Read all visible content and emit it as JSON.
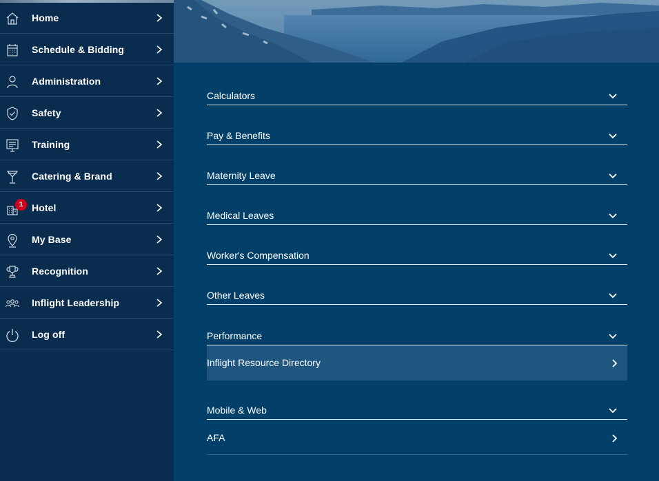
{
  "sidebar": {
    "items": [
      {
        "label": "Home",
        "icon": "home-icon"
      },
      {
        "label": "Schedule & Bidding",
        "icon": "calendar-icon"
      },
      {
        "label": "Administration",
        "icon": "person-icon"
      },
      {
        "label": "Safety",
        "icon": "shield-check-icon"
      },
      {
        "label": "Training",
        "icon": "presentation-board-icon"
      },
      {
        "label": "Catering & Brand",
        "icon": "cocktail-glass-icon"
      },
      {
        "label": "Hotel",
        "icon": "hotel-building-icon",
        "badge": "1"
      },
      {
        "label": "My Base",
        "icon": "map-pin-icon"
      },
      {
        "label": "Recognition",
        "icon": "trophy-icon"
      },
      {
        "label": "Inflight Leadership",
        "icon": "people-group-icon"
      },
      {
        "label": "Log off",
        "icon": "power-icon"
      }
    ]
  },
  "accordion": {
    "sections": [
      {
        "label": "Calculators"
      },
      {
        "label": "Pay & Benefits"
      },
      {
        "label": "Maternity Leave"
      },
      {
        "label": "Medical Leaves"
      },
      {
        "label": "Worker's Compensation"
      },
      {
        "label": "Other Leaves"
      },
      {
        "label": "Performance"
      },
      {
        "label": "Mobile & Web"
      }
    ],
    "links": [
      {
        "label": "Inflight Resource Directory"
      },
      {
        "label": "AFA"
      }
    ]
  },
  "colors": {
    "sidebar_bg": "#0a2d4f",
    "main_bg": "#024069",
    "highlight_row": "#1f5680",
    "badge": "#d0021b"
  }
}
